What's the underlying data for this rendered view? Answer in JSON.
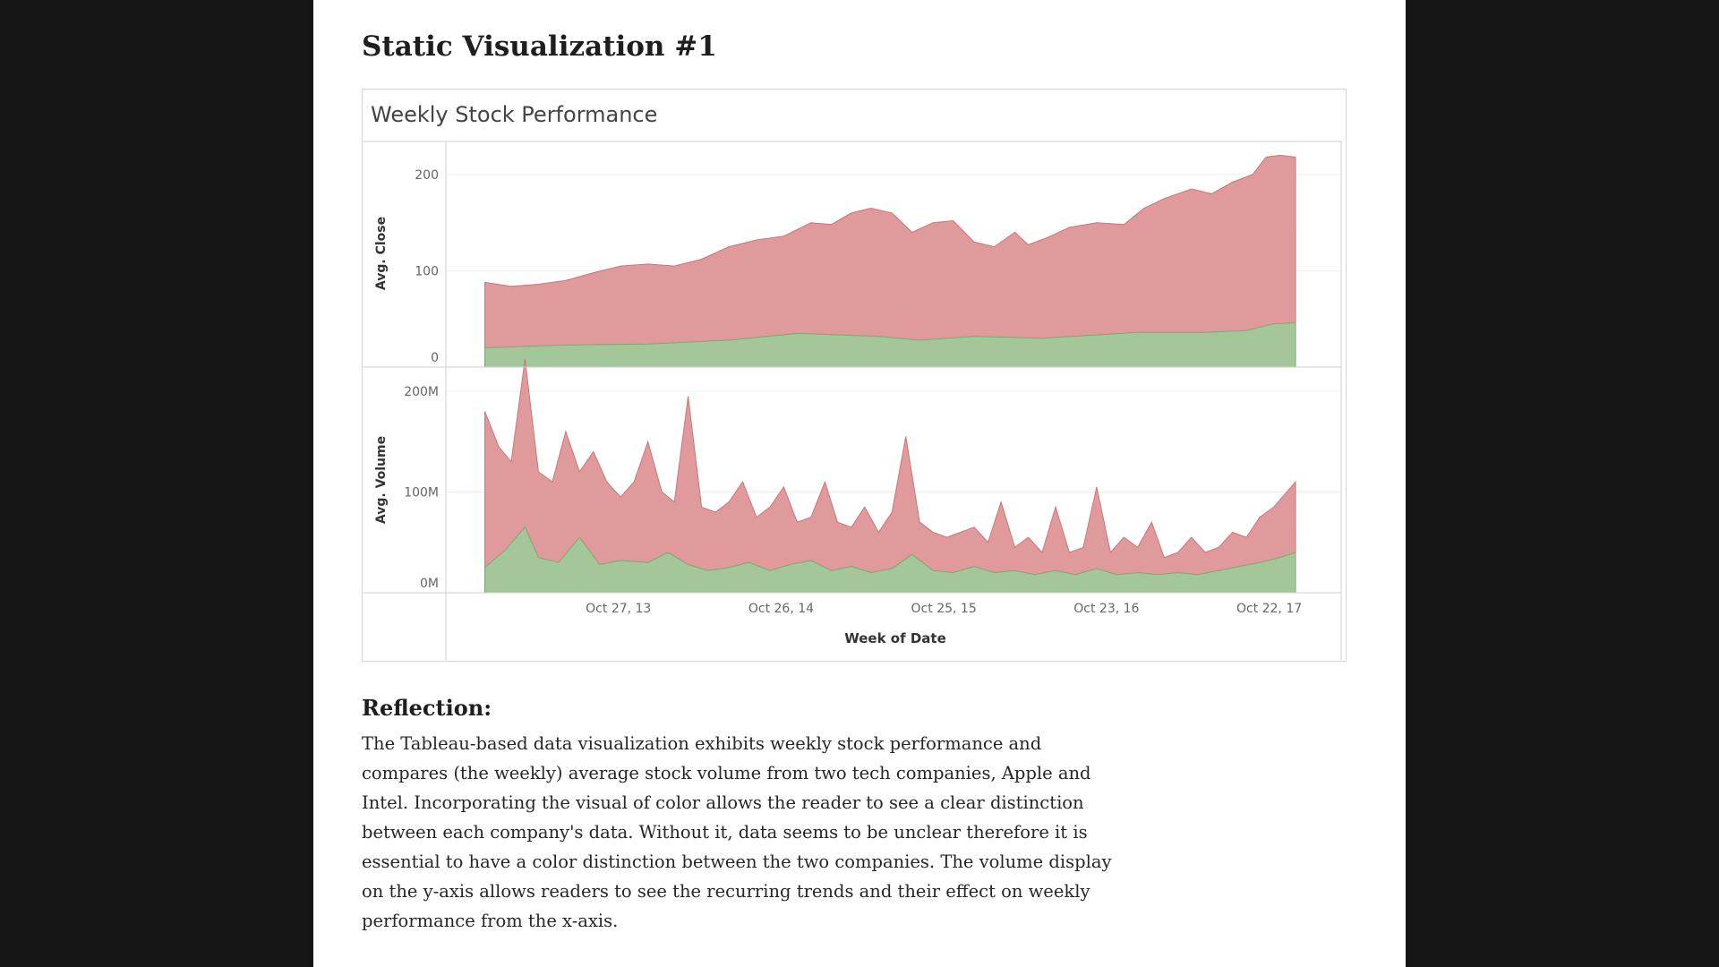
{
  "page": {
    "heading": "Static Visualization #1",
    "reflection_heading": "Reflection:",
    "reflection_text": "The Tableau-based data visualization exhibits weekly stock performance and compares (the weekly) average stock volume from two tech companies, Apple and Intel. Incorporating the visual of color allows the reader to see a clear distinction between each company's data. Without it, data seems to be unclear therefore it is essential to have a color distinction between the two companies. The volume display on the y-axis allows readers to see the recurring trends and their effect on weekly performance from the x-axis."
  },
  "colors": {
    "red_series": "#e09a9b",
    "red_line": "#c77779",
    "green_series": "#a3c799",
    "green_line": "#7fa870",
    "axis": "#cfcfcf",
    "grid": "#efefef",
    "dark_background": "#161616"
  },
  "chart_data": {
    "type": "area",
    "title": "Weekly Stock Performance",
    "xlabel": "Week of Date",
    "x_start": "2012-12-31",
    "x_end": "2018-01-01",
    "x_ticks": [
      {
        "label": "Oct 27, 13",
        "date": "2013-10-27"
      },
      {
        "label": "Oct 26, 14",
        "date": "2014-10-26"
      },
      {
        "label": "Oct 25, 15",
        "date": "2015-10-25"
      },
      {
        "label": "Oct 23, 16",
        "date": "2016-10-23"
      },
      {
        "label": "Oct 22, 17",
        "date": "2017-10-22"
      }
    ],
    "panels": [
      {
        "ylabel": "Avg. Close",
        "ylim": [
          0,
          225
        ],
        "y_ticks": [
          {
            "value": 0,
            "label": "0"
          },
          {
            "value": 100,
            "label": "100"
          },
          {
            "value": 200,
            "label": "200"
          }
        ],
        "series": [
          {
            "color": "#e09a9b",
            "points": [
              [
                "2013-01-01",
                88
              ],
              [
                "2013-03-01",
                84
              ],
              [
                "2013-05-01",
                86
              ],
              [
                "2013-07-01",
                90
              ],
              [
                "2013-09-01",
                98
              ],
              [
                "2013-11-01",
                105
              ],
              [
                "2014-01-01",
                107
              ],
              [
                "2014-03-01",
                105
              ],
              [
                "2014-05-01",
                112
              ],
              [
                "2014-07-01",
                125
              ],
              [
                "2014-09-01",
                132
              ],
              [
                "2014-11-01",
                136
              ],
              [
                "2015-01-01",
                150
              ],
              [
                "2015-02-15",
                148
              ],
              [
                "2015-04-01",
                160
              ],
              [
                "2015-05-15",
                165
              ],
              [
                "2015-07-01",
                160
              ],
              [
                "2015-08-15",
                140
              ],
              [
                "2015-10-01",
                150
              ],
              [
                "2015-11-15",
                152
              ],
              [
                "2016-01-01",
                130
              ],
              [
                "2016-02-15",
                125
              ],
              [
                "2016-04-01",
                140
              ],
              [
                "2016-05-01",
                127
              ],
              [
                "2016-06-15",
                135
              ],
              [
                "2016-08-01",
                145
              ],
              [
                "2016-10-01",
                150
              ],
              [
                "2016-12-01",
                148
              ],
              [
                "2017-01-15",
                165
              ],
              [
                "2017-03-01",
                175
              ],
              [
                "2017-05-01",
                185
              ],
              [
                "2017-06-15",
                180
              ],
              [
                "2017-08-01",
                192
              ],
              [
                "2017-09-15",
                200
              ],
              [
                "2017-10-15",
                218
              ],
              [
                "2017-11-15",
                220
              ],
              [
                "2017-12-20",
                218
              ]
            ]
          },
          {
            "color": "#a3c799",
            "points": [
              [
                "2013-01-01",
                20
              ],
              [
                "2013-07-01",
                23
              ],
              [
                "2014-01-01",
                24
              ],
              [
                "2014-07-01",
                28
              ],
              [
                "2014-12-01",
                35
              ],
              [
                "2015-06-01",
                32
              ],
              [
                "2015-09-01",
                28
              ],
              [
                "2016-01-01",
                32
              ],
              [
                "2016-06-01",
                30
              ],
              [
                "2017-01-01",
                36
              ],
              [
                "2017-06-01",
                36
              ],
              [
                "2017-09-01",
                38
              ],
              [
                "2017-11-01",
                45
              ],
              [
                "2017-12-20",
                46
              ]
            ]
          }
        ]
      },
      {
        "ylabel": "Avg. Volume",
        "ylim": [
          0,
          215
        ],
        "y_ticks": [
          {
            "value": 0,
            "label": "0M"
          },
          {
            "value": 100,
            "label": "100M"
          },
          {
            "value": 200,
            "label": "200M"
          }
        ],
        "series": [
          {
            "color": "#e09a9b",
            "points": [
              [
                "2013-01-01",
                180
              ],
              [
                "2013-02-01",
                145
              ],
              [
                "2013-03-01",
                130
              ],
              [
                "2013-04-01",
                232
              ],
              [
                "2013-05-01",
                120
              ],
              [
                "2013-06-01",
                110
              ],
              [
                "2013-07-01",
                160
              ],
              [
                "2013-08-01",
                120
              ],
              [
                "2013-09-01",
                140
              ],
              [
                "2013-10-01",
                110
              ],
              [
                "2013-11-01",
                95
              ],
              [
                "2013-12-01",
                110
              ],
              [
                "2014-01-01",
                150
              ],
              [
                "2014-02-01",
                100
              ],
              [
                "2014-03-01",
                90
              ],
              [
                "2014-04-01",
                195
              ],
              [
                "2014-05-01",
                85
              ],
              [
                "2014-06-01",
                80
              ],
              [
                "2014-07-01",
                90
              ],
              [
                "2014-08-01",
                110
              ],
              [
                "2014-09-01",
                75
              ],
              [
                "2014-10-01",
                85
              ],
              [
                "2014-11-01",
                105
              ],
              [
                "2014-12-01",
                70
              ],
              [
                "2015-01-01",
                75
              ],
              [
                "2015-02-01",
                110
              ],
              [
                "2015-03-01",
                70
              ],
              [
                "2015-04-01",
                65
              ],
              [
                "2015-05-01",
                85
              ],
              [
                "2015-06-01",
                60
              ],
              [
                "2015-07-01",
                80
              ],
              [
                "2015-08-01",
                155
              ],
              [
                "2015-09-01",
                70
              ],
              [
                "2015-10-01",
                60
              ],
              [
                "2015-11-01",
                55
              ],
              [
                "2015-12-01",
                60
              ],
              [
                "2016-01-01",
                65
              ],
              [
                "2016-02-01",
                50
              ],
              [
                "2016-03-01",
                90
              ],
              [
                "2016-04-01",
                45
              ],
              [
                "2016-05-01",
                55
              ],
              [
                "2016-06-01",
                40
              ],
              [
                "2016-07-01",
                85
              ],
              [
                "2016-08-01",
                40
              ],
              [
                "2016-09-01",
                45
              ],
              [
                "2016-10-01",
                105
              ],
              [
                "2016-11-01",
                40
              ],
              [
                "2016-12-01",
                55
              ],
              [
                "2017-01-01",
                45
              ],
              [
                "2017-02-01",
                70
              ],
              [
                "2017-03-01",
                35
              ],
              [
                "2017-04-01",
                40
              ],
              [
                "2017-05-01",
                55
              ],
              [
                "2017-06-01",
                40
              ],
              [
                "2017-07-01",
                45
              ],
              [
                "2017-08-01",
                60
              ],
              [
                "2017-09-01",
                55
              ],
              [
                "2017-10-01",
                75
              ],
              [
                "2017-11-01",
                85
              ],
              [
                "2017-12-20",
                110
              ]
            ]
          },
          {
            "color": "#a3c799",
            "points": [
              [
                "2013-01-01",
                25
              ],
              [
                "2013-02-15",
                42
              ],
              [
                "2013-04-01",
                65
              ],
              [
                "2013-05-01",
                35
              ],
              [
                "2013-06-15",
                30
              ],
              [
                "2013-08-01",
                55
              ],
              [
                "2013-09-15",
                28
              ],
              [
                "2013-11-01",
                32
              ],
              [
                "2014-01-01",
                30
              ],
              [
                "2014-02-15",
                40
              ],
              [
                "2014-04-01",
                28
              ],
              [
                "2014-05-15",
                22
              ],
              [
                "2014-07-01",
                25
              ],
              [
                "2014-08-15",
                30
              ],
              [
                "2014-10-01",
                22
              ],
              [
                "2014-11-15",
                28
              ],
              [
                "2015-01-01",
                32
              ],
              [
                "2015-02-15",
                22
              ],
              [
                "2015-04-01",
                26
              ],
              [
                "2015-05-15",
                20
              ],
              [
                "2015-07-01",
                24
              ],
              [
                "2015-08-15",
                38
              ],
              [
                "2015-10-01",
                22
              ],
              [
                "2015-11-15",
                20
              ],
              [
                "2016-01-01",
                26
              ],
              [
                "2016-02-15",
                20
              ],
              [
                "2016-04-01",
                22
              ],
              [
                "2016-05-15",
                18
              ],
              [
                "2016-07-01",
                22
              ],
              [
                "2016-08-15",
                18
              ],
              [
                "2016-10-01",
                24
              ],
              [
                "2016-11-15",
                18
              ],
              [
                "2017-01-01",
                20
              ],
              [
                "2017-02-15",
                18
              ],
              [
                "2017-04-01",
                20
              ],
              [
                "2017-05-15",
                18
              ],
              [
                "2017-07-01",
                22
              ],
              [
                "2017-08-15",
                26
              ],
              [
                "2017-10-01",
                30
              ],
              [
                "2017-11-15",
                35
              ],
              [
                "2017-12-20",
                40
              ]
            ]
          }
        ]
      }
    ]
  }
}
